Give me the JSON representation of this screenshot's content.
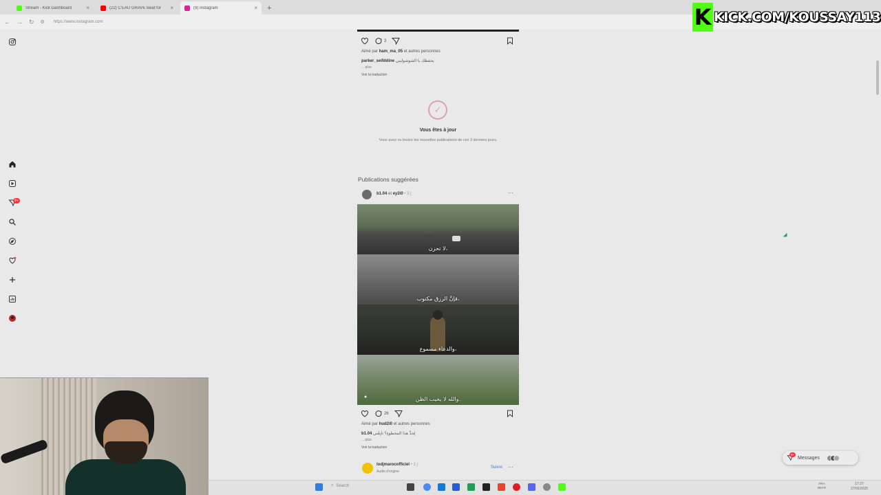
{
  "browser": {
    "tabs": [
      {
        "title": "Stream - Kick Dashboard",
        "favicon_color": "#53fc18",
        "active": false
      },
      {
        "title": "(22) C'EAU GRAVE Beat for",
        "favicon_color": "#ff0000",
        "active": false
      },
      {
        "title": "(9) Instagram",
        "favicon_color": "#d6249f",
        "active": true
      }
    ],
    "new_tab_label": "+",
    "url": "https://www.instagram.com"
  },
  "overlay": {
    "kick_logo": "K",
    "kick_handle": "KICK.COM/KOUSSAY113",
    "brand_color": "#53fc18"
  },
  "nav": {
    "icons": [
      "instagram-icon",
      "home-icon",
      "reels-icon",
      "messenger-icon",
      "search-icon",
      "explore-icon",
      "heart-icon",
      "create-icon",
      "dashboard-icon",
      "profile-icon"
    ],
    "messages_badge": "9+"
  },
  "post1": {
    "comments_count": "3",
    "liked_by_prefix": "Aimé par",
    "liked_by_user": "ham_ma_05",
    "liked_by_suffix": "et autres personnes",
    "author": "parker_seifddine",
    "caption": "يحفظك يا الشوشوليني",
    "more": "... plus",
    "translate": "Voir la traduction"
  },
  "caught_up": {
    "title": "Vous êtes à jour",
    "subtitle": "Vous avez vu toutes les nouvelles publications de ces 3 derniers jours."
  },
  "suggested": {
    "heading": "Publications suggérées",
    "post": {
      "author": "b1.04",
      "and": "et",
      "coauthor": "ey2i0",
      "time": "• 3 j",
      "captions": [
        "لا تحزن،",
        "فإنَّ الرزق مكتوب،",
        "والدعاء مسموع،",
        "والله لا يخيب الظن."
      ],
      "comments_count": "26",
      "liked_by_prefix": "Aimé par",
      "liked_by_user": "hud2i0",
      "liked_by_suffix": "et autres personnes",
      "caption_author": "b1.04",
      "caption_text": "لِحدِّ هذا المخطوءِ؟ تابِعُني",
      "more": "... plus",
      "translate": "Voir la traduction"
    },
    "next_post": {
      "author": "lodjmarocofficiel",
      "time": "• 1 j",
      "subtitle": "Audio d'origine",
      "follow": "Suivre"
    }
  },
  "messages": {
    "label": "Messages",
    "badge": "9+"
  },
  "taskbar": {
    "search_placeholder": "Search",
    "lang_top": "FRA",
    "lang_bottom": "BEFR",
    "time": "17:27",
    "date": "27/02/2025"
  }
}
